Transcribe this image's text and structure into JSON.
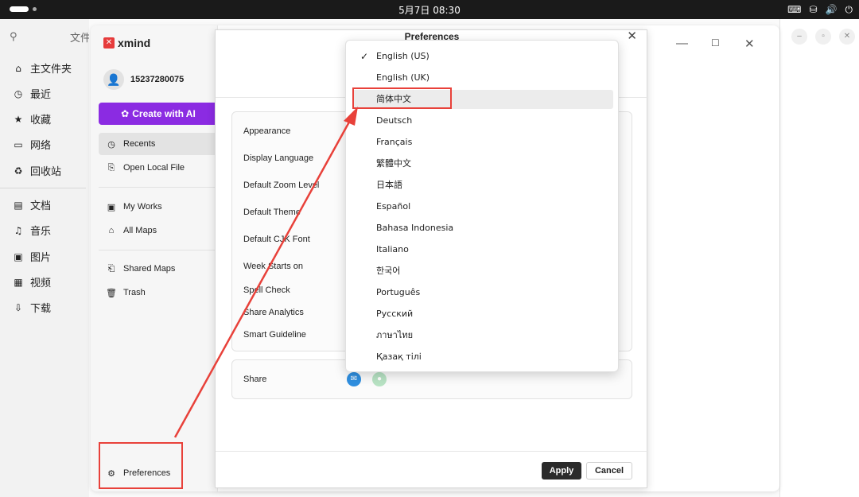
{
  "system_bar": {
    "clock": "5月7日 08:30",
    "tray_icons": [
      "keyboard-icon",
      "network-icon",
      "volume-icon",
      "power-icon"
    ]
  },
  "file_manager": {
    "title_fragment": "文件",
    "places": [
      {
        "icon": "home-icon",
        "label": "主文件夹"
      },
      {
        "icon": "recent-icon",
        "label": "最近"
      },
      {
        "icon": "star-icon",
        "label": "收藏"
      },
      {
        "icon": "network-icon",
        "label": "网络"
      },
      {
        "icon": "trash-icon",
        "label": "回收站"
      }
    ],
    "folders": [
      {
        "icon": "document-icon",
        "label": "文档"
      },
      {
        "icon": "music-icon",
        "label": "音乐"
      },
      {
        "icon": "picture-icon",
        "label": "图片"
      },
      {
        "icon": "video-icon",
        "label": "视频"
      },
      {
        "icon": "download-icon",
        "label": "下载"
      }
    ]
  },
  "xmind": {
    "logo_text": "xmind",
    "user": "15237280075",
    "create_ai": "Create with AI",
    "nav": {
      "recents": "Recents",
      "open_local_file": "Open Local File",
      "my_works": "My Works",
      "all_maps": "All Maps",
      "shared_maps": "Shared Maps",
      "trash": "Trash",
      "preferences": "Preferences"
    }
  },
  "preferences": {
    "title": "Preferences",
    "labels": {
      "appearance": "Appearance",
      "display_language": "Display Language",
      "default_zoom_level": "Default Zoom Level",
      "default_theme": "Default Theme",
      "default_cjk_font": "Default CJK Font",
      "week_starts_on": "Week Starts on",
      "spell_check": "Spell Check",
      "share_analytics": "Share Analytics",
      "smart_guideline": "Smart Guideline",
      "share": "Share"
    },
    "apply": "Apply",
    "cancel": "Cancel"
  },
  "language_menu": {
    "selected": "English (US)",
    "highlighted": "简体中文",
    "items": [
      "English (US)",
      "English (UK)",
      "简体中文",
      "Deutsch",
      "Français",
      "繁體中文",
      "日本語",
      "Español",
      "Bahasa Indonesia",
      "Italiano",
      "한국어",
      "Português",
      "Русский",
      "ภาษาไทย",
      "Қазақ тілі"
    ]
  },
  "colors": {
    "annotation_red": "#e8413a",
    "ai_purple": "#8b2be2",
    "apply_dark": "#2b2b2b"
  }
}
